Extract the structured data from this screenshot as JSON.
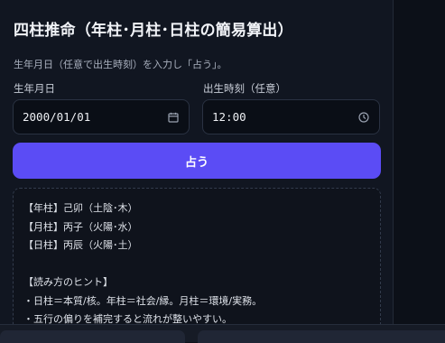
{
  "app": {
    "title": "四柱推命（年柱･月柱･日柱の簡易算出）",
    "description": "生年月日（任意で出生時刻）を入力し「占う」。"
  },
  "form": {
    "date_label": "生年月日",
    "date_value": "2000/01/01",
    "time_label": "出生時刻（任意）",
    "time_value": "12:00",
    "submit_label": "占う"
  },
  "icons": {
    "date": "calendar-icon",
    "time": "clock-icon"
  },
  "colors": {
    "accent": "#5b4cf5",
    "background": "#111621"
  },
  "result": {
    "lines": [
      "【年柱】己卯（土陰･木）",
      "【月柱】丙子（火陽･水）",
      "【日柱】丙辰（火陽･土）",
      "",
      "【読み方のヒント】",
      "・日柱＝本質/核。年柱＝社会/縁。月柱＝環境/実務。",
      "・五行の偏りを補完すると流れが整いやすい。"
    ]
  }
}
